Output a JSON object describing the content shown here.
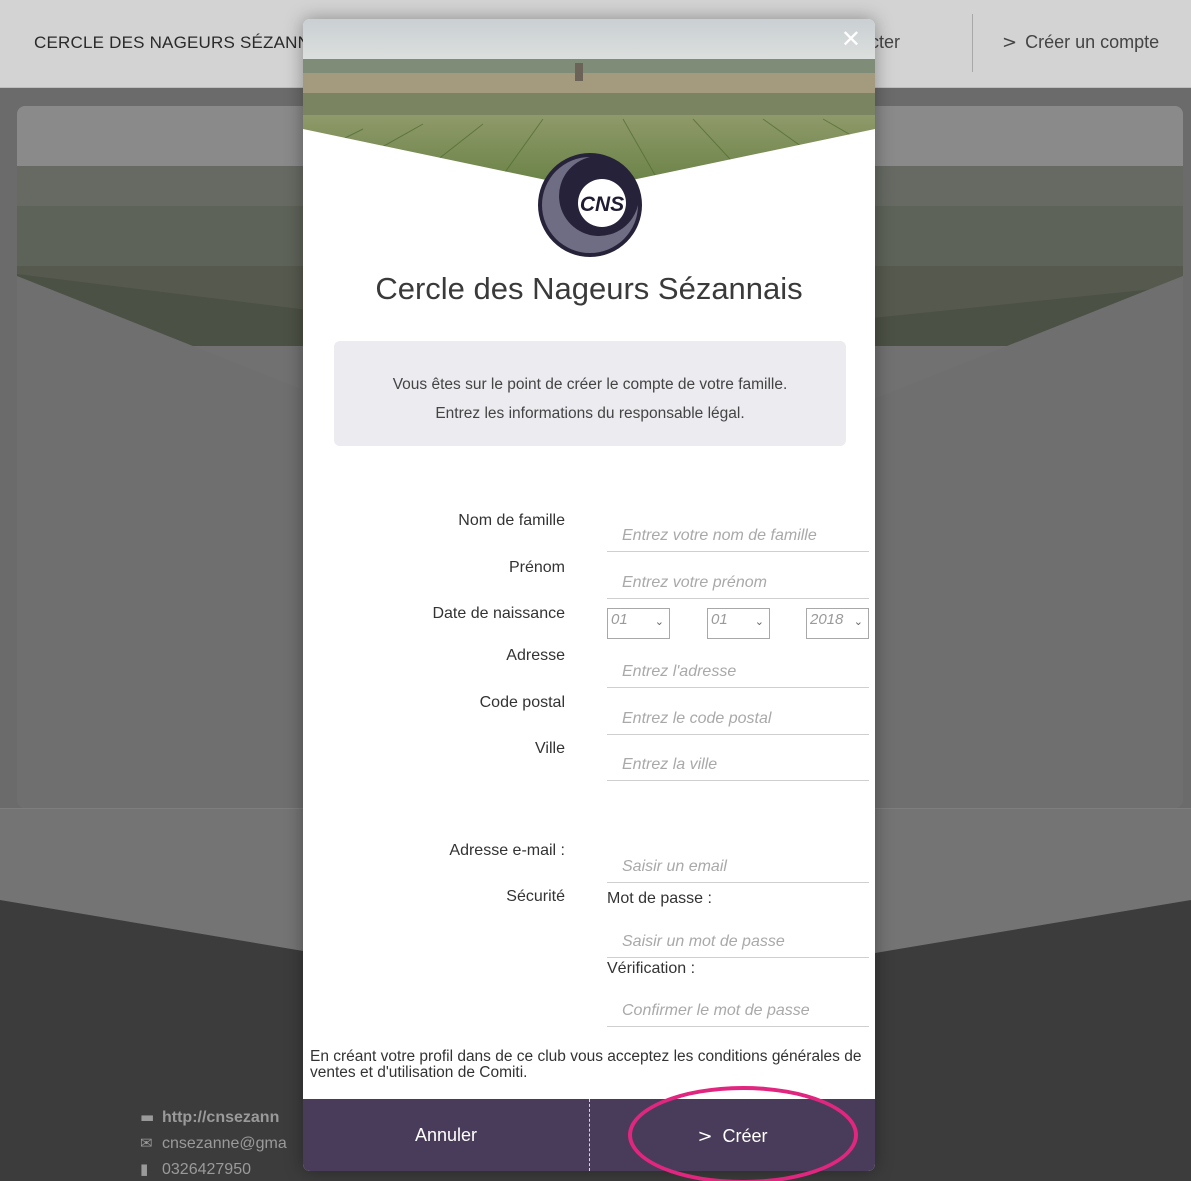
{
  "nav": {
    "brand": "CERCLE DES NAGEURS SÉZANN",
    "login": "nnecter",
    "create_account": "Créer un compte"
  },
  "footer": {
    "website": "http://cnsezann",
    "email": "cnsezanne@gma",
    "phone": "0326427950"
  },
  "modal": {
    "club_name": "Cercle des Nageurs Sézannais",
    "info_line1": "Vous êtes sur le point de créer le compte de votre famille.",
    "info_line2": "Entrez les informations du responsable légal.",
    "form": {
      "nom_label": "Nom de famille",
      "nom_placeholder": "Entrez votre nom de famille",
      "prenom_label": "Prénom",
      "prenom_placeholder": "Entrez votre prénom",
      "dob_label": "Date de naissance",
      "dob_day": "01",
      "dob_month": "01",
      "dob_year": "2018",
      "adresse_label": "Adresse",
      "adresse_placeholder": "Entrez l'adresse",
      "cp_label": "Code postal",
      "cp_placeholder": "Entrez le code postal",
      "ville_label": "Ville",
      "ville_placeholder": "Entrez la ville",
      "email_label": "Adresse e-mail :",
      "email_placeholder": "Saisir un email",
      "securite_label": "Sécurité",
      "password_label": "Mot de passe :",
      "password_placeholder": "Saisir un mot de passe",
      "verif_label": "Vérification :",
      "verif_placeholder": "Confirmer le mot de passe"
    },
    "terms": "En créant votre profil dans de ce club vous acceptez les conditions générales de ventes et d'utilisation de Comiti.",
    "cancel": "Annuler",
    "create": "Créer"
  },
  "logo_text": "CNS",
  "colors": {
    "footer_bar": "#493c5a",
    "highlight": "#e0267f",
    "info_box": "#ebebf0"
  }
}
